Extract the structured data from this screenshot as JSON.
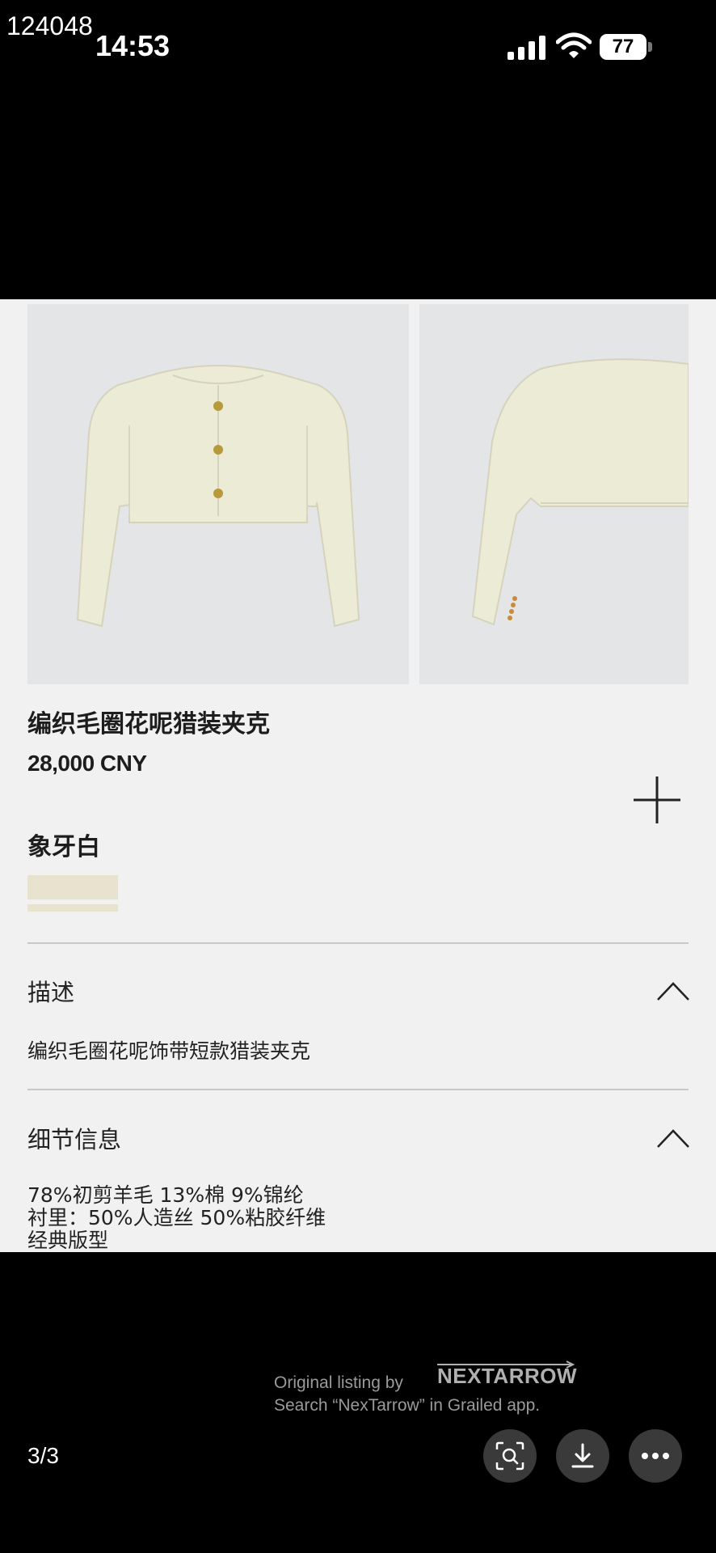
{
  "watermark": "124048",
  "status_bar": {
    "time": "14:53",
    "battery": "77"
  },
  "product": {
    "title": "编织毛圈花呢猎装夹克",
    "price": "28,000 CNY",
    "color_name": "象牙白",
    "swatch_color": "#e7e3cf"
  },
  "sections": {
    "description": {
      "title": "描述",
      "text": "编织毛圈花呢饰带短款猎装夹克"
    },
    "details": {
      "title": "细节信息",
      "lines": [
        "78%初剪羊毛 13%棉 9%锦纶",
        "衬里：50%人造丝 50%粘胶纤维",
        "经典版型"
      ]
    }
  },
  "overlay": {
    "listing_text": "Original listing by",
    "brand": "NEXTARROW",
    "search_hint": "Search “NexTarrow” in Grailed app.",
    "page_counter": "3/3"
  },
  "icons": [
    "signal-icon",
    "wifi-icon",
    "battery-icon",
    "plus-icon",
    "chevron-up-icon",
    "visual-search-icon",
    "download-icon",
    "more-icon"
  ]
}
